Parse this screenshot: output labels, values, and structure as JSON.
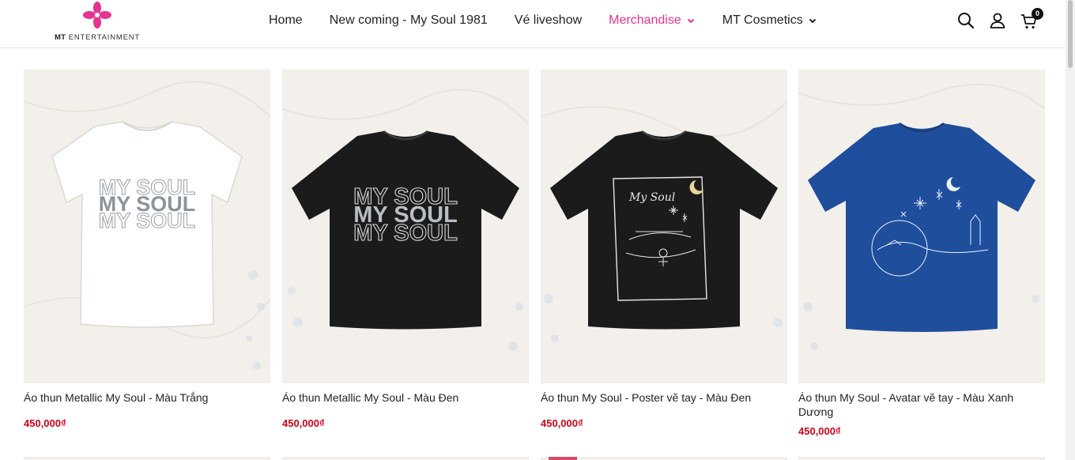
{
  "brand": {
    "logo_text_bold": "MT",
    "logo_text_rest": " ENTERTAINMENT",
    "logo_color": "#e5338f"
  },
  "nav": {
    "items": [
      {
        "label": "Home"
      },
      {
        "label": "New coming - My Soul 1981"
      },
      {
        "label": "Vé liveshow"
      },
      {
        "label": "Merchandise",
        "active": true
      },
      {
        "label": "MT Cosmetics"
      }
    ]
  },
  "header_icons": [
    "search-icon",
    "user-icon",
    "cart-icon"
  ],
  "cart": {
    "count": "0"
  },
  "colors": {
    "accent": "#e5338f",
    "price": "#d0021b"
  },
  "products": [
    {
      "name": "Áo thun Metallic My Soul - Màu Trắng",
      "price": "450,000₫",
      "shirt_color": "#ffffff",
      "print_text": "MY SOUL"
    },
    {
      "name": "Áo thun Metallic My Soul - Màu Đen",
      "price": "450,000₫",
      "shirt_color": "#1b1b1b",
      "print_text": "MY SOUL"
    },
    {
      "name": "Áo thun My Soul - Poster vẽ tay - Màu Đen",
      "price": "450,000₫",
      "shirt_color": "#1b1b1b",
      "print_text": "My Soul"
    },
    {
      "name": "Áo thun My Soul - Avatar vẽ tay - Màu Xanh Dương",
      "price": "450,000₫",
      "shirt_color": "#1f4e9c",
      "print_text": ""
    }
  ]
}
